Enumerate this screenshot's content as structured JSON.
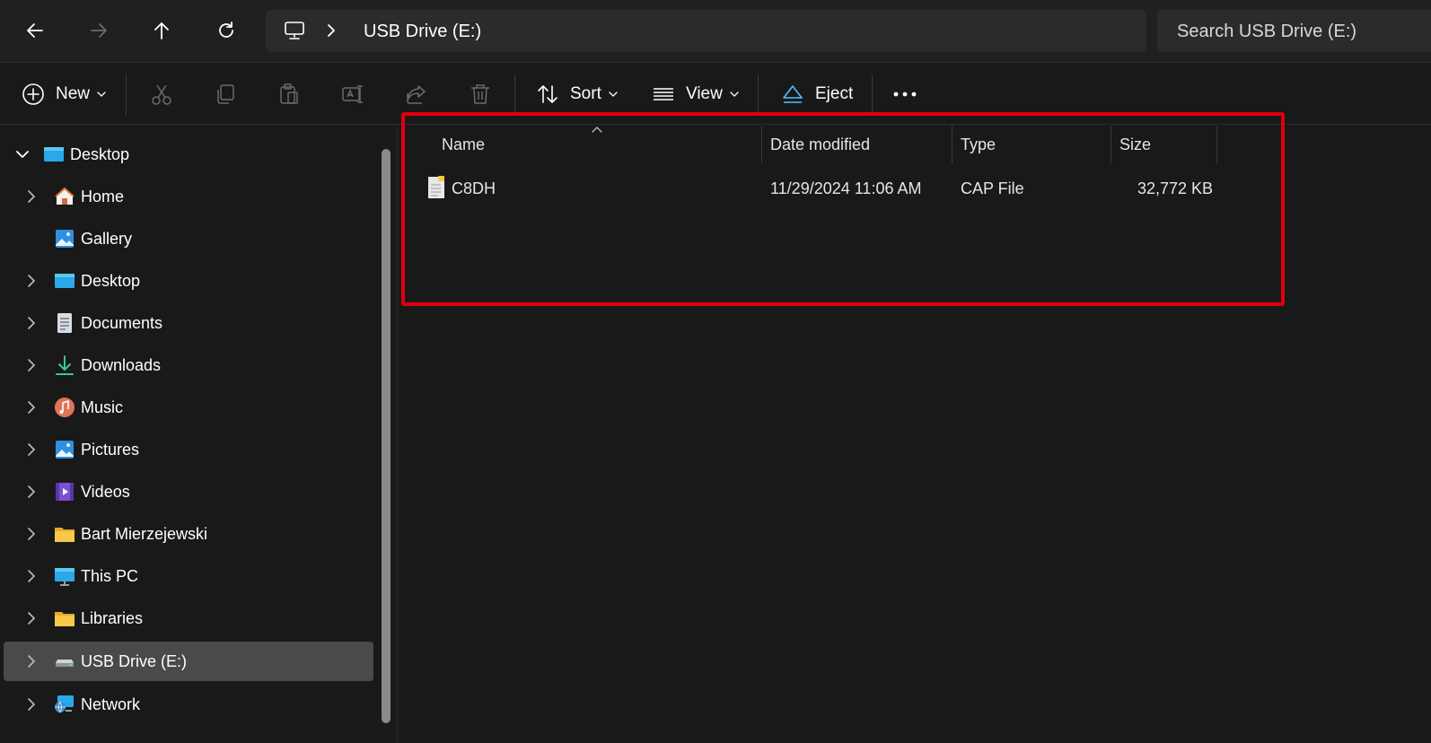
{
  "address_bar": {
    "location_icon": "this-pc-icon",
    "separator_icon": "chevron-right-icon",
    "breadcrumb": "USB Drive (E:)"
  },
  "search": {
    "placeholder": "Search USB Drive (E:)"
  },
  "nav": {
    "back_icon": "arrow-left-icon",
    "forward_icon": "arrow-right-icon",
    "up_icon": "arrow-up-icon",
    "refresh_icon": "refresh-icon"
  },
  "commands": {
    "new_label": "New",
    "sort_label": "Sort",
    "view_label": "View",
    "eject_label": "Eject",
    "disabled_icons": [
      "cut-icon",
      "copy-icon",
      "paste-icon",
      "rename-icon",
      "share-icon",
      "delete-icon"
    ],
    "more_icon": "more-icon"
  },
  "sidebar": {
    "items": [
      {
        "label": "Desktop",
        "icon": "desktop-icon"
      },
      {
        "label": "Home",
        "icon": "home-icon"
      },
      {
        "label": "Gallery",
        "icon": "gallery-icon"
      },
      {
        "label": "Desktop",
        "icon": "desktop-icon"
      },
      {
        "label": "Documents",
        "icon": "documents-icon"
      },
      {
        "label": "Downloads",
        "icon": "downloads-icon"
      },
      {
        "label": "Music",
        "icon": "music-icon"
      },
      {
        "label": "Pictures",
        "icon": "pictures-icon"
      },
      {
        "label": "Videos",
        "icon": "videos-icon"
      },
      {
        "label": "Bart Mierzejewski",
        "icon": "folder-icon"
      },
      {
        "label": "This PC",
        "icon": "this-pc-icon"
      },
      {
        "label": "Libraries",
        "icon": "folder-icon"
      },
      {
        "label": "USB Drive (E:)",
        "icon": "usb-drive-icon"
      },
      {
        "label": "Network",
        "icon": "network-icon"
      }
    ],
    "selected": "USB Drive (E:)"
  },
  "file_list": {
    "columns": [
      "Name",
      "Date modified",
      "Type",
      "Size"
    ],
    "sorted_by": "Name",
    "rows": [
      {
        "name": "C8DH",
        "date_modified": "11/29/2024 11:06 AM",
        "type": "CAP File",
        "size": "32,772 KB",
        "icon": "file-icon"
      }
    ]
  },
  "colors": {
    "background": "#191919",
    "toolbar": "#202020",
    "field": "#2b2b2b",
    "selection": "#4a4a4a",
    "highlight_box": "#e0000b",
    "accent": "#4cc2ff"
  }
}
